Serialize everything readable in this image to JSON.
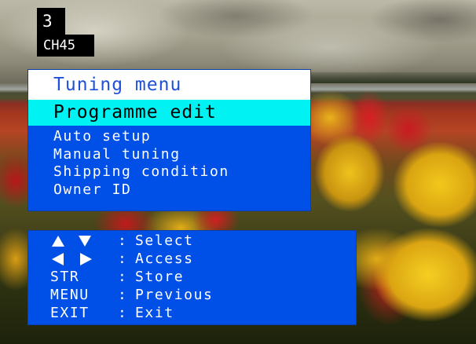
{
  "channel": {
    "number": "3",
    "name": "CH45"
  },
  "menu": {
    "title": "Tuning menu",
    "selected_item": "Programme edit",
    "items": [
      "Auto setup",
      "Manual tuning",
      "Shipping condition",
      "Owner ID"
    ]
  },
  "help": {
    "rows": [
      {
        "key": "",
        "key_icons": [
          "triangle-up-icon",
          "triangle-down-icon"
        ],
        "separator": ":",
        "action": "Select"
      },
      {
        "key": "",
        "key_icons": [
          "triangle-left-icon",
          "triangle-right-icon"
        ],
        "separator": ":",
        "action": "Access"
      },
      {
        "key": "STR",
        "separator": ":",
        "action": "Store"
      },
      {
        "key": "MENU",
        "separator": ":",
        "action": "Previous"
      },
      {
        "key": "EXIT",
        "separator": ":",
        "action": "Exit"
      }
    ]
  },
  "colors": {
    "panel_blue": "#0050e8",
    "title_background": "#ffffff",
    "title_text": "#1f50d8",
    "highlight_cyan": "#00f2f2",
    "channel_badge": "#000000"
  }
}
